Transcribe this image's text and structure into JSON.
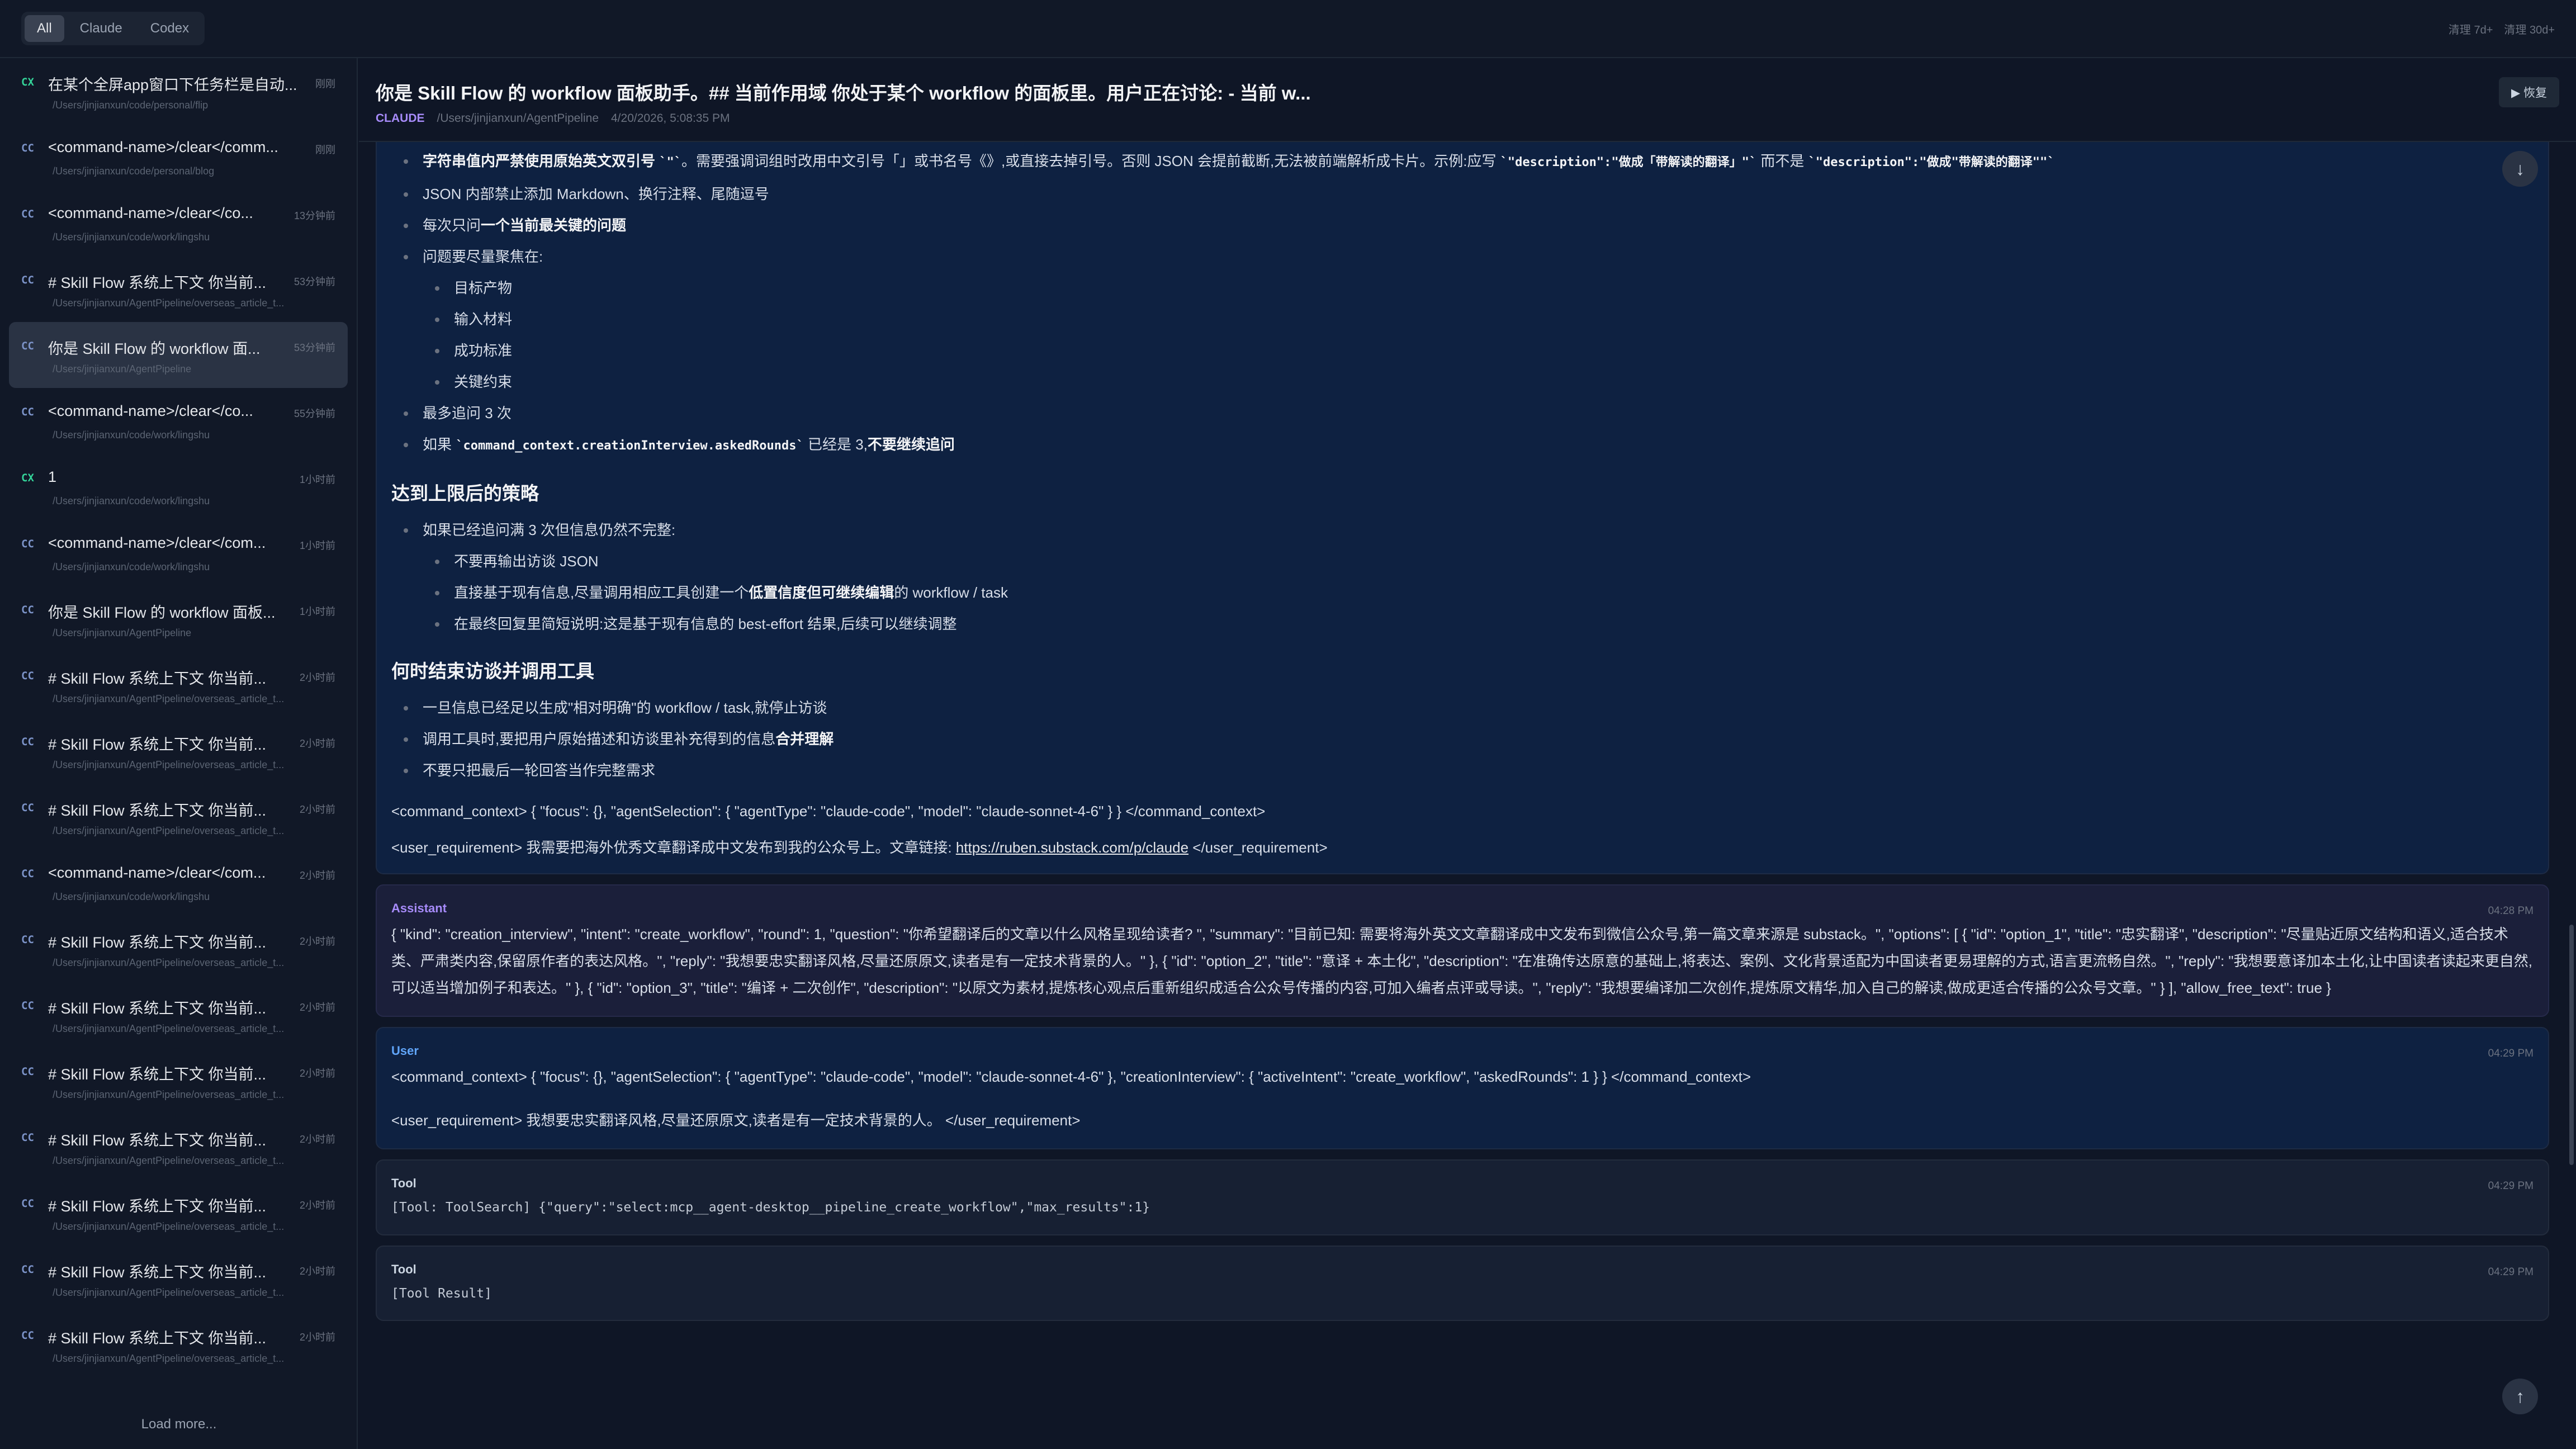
{
  "filters": {
    "items": [
      "All",
      "Claude",
      "Codex"
    ],
    "active": "All"
  },
  "topbar": {
    "clean_7d": "清理 7d+",
    "clean_30d": "清理 30d+"
  },
  "sidebar": {
    "sessions": [
      {
        "tag": "CX",
        "title": "在某个全屏app窗口下任务栏是自动...",
        "time": "刚刚",
        "path": "/Users/jinjianxun/code/personal/flip"
      },
      {
        "tag": "CC",
        "title": "<command-name>/clear</comm...",
        "time": "刚刚",
        "path": "/Users/jinjianxun/code/personal/blog"
      },
      {
        "tag": "CC",
        "title": "<command-name>/clear</co...",
        "time": "13分钟前",
        "path": "/Users/jinjianxun/code/work/lingshu"
      },
      {
        "tag": "CC",
        "title": "# Skill Flow 系统上下文 你当前...",
        "time": "53分钟前",
        "path": "/Users/jinjianxun/AgentPipeline/overseas_article_t..."
      },
      {
        "tag": "CC",
        "title": "你是 Skill Flow 的 workflow 面...",
        "time": "53分钟前",
        "path": "/Users/jinjianxun/AgentPipeline"
      },
      {
        "tag": "CC",
        "title": "<command-name>/clear</co...",
        "time": "55分钟前",
        "path": "/Users/jinjianxun/code/work/lingshu"
      },
      {
        "tag": "CX",
        "title": "1",
        "time": "1小时前",
        "path": "/Users/jinjianxun/code/work/lingshu"
      },
      {
        "tag": "CC",
        "title": "<command-name>/clear</com...",
        "time": "1小时前",
        "path": "/Users/jinjianxun/code/work/lingshu"
      },
      {
        "tag": "CC",
        "title": "你是 Skill Flow 的 workflow 面板...",
        "time": "1小时前",
        "path": "/Users/jinjianxun/AgentPipeline"
      },
      {
        "tag": "CC",
        "title": "# Skill Flow 系统上下文 你当前...",
        "time": "2小时前",
        "path": "/Users/jinjianxun/AgentPipeline/overseas_article_t..."
      },
      {
        "tag": "CC",
        "title": "# Skill Flow 系统上下文 你当前...",
        "time": "2小时前",
        "path": "/Users/jinjianxun/AgentPipeline/overseas_article_t..."
      },
      {
        "tag": "CC",
        "title": "# Skill Flow 系统上下文 你当前...",
        "time": "2小时前",
        "path": "/Users/jinjianxun/AgentPipeline/overseas_article_t..."
      },
      {
        "tag": "CC",
        "title": "<command-name>/clear</com...",
        "time": "2小时前",
        "path": "/Users/jinjianxun/code/work/lingshu"
      },
      {
        "tag": "CC",
        "title": "# Skill Flow 系统上下文 你当前...",
        "time": "2小时前",
        "path": "/Users/jinjianxun/AgentPipeline/overseas_article_t..."
      },
      {
        "tag": "CC",
        "title": "# Skill Flow 系统上下文 你当前...",
        "time": "2小时前",
        "path": "/Users/jinjianxun/AgentPipeline/overseas_article_t..."
      },
      {
        "tag": "CC",
        "title": "# Skill Flow 系统上下文 你当前...",
        "time": "2小时前",
        "path": "/Users/jinjianxun/AgentPipeline/overseas_article_t..."
      },
      {
        "tag": "CC",
        "title": "# Skill Flow 系统上下文 你当前...",
        "time": "2小时前",
        "path": "/Users/jinjianxun/AgentPipeline/overseas_article_t..."
      },
      {
        "tag": "CC",
        "title": "# Skill Flow 系统上下文 你当前...",
        "time": "2小时前",
        "path": "/Users/jinjianxun/AgentPipeline/overseas_article_t..."
      },
      {
        "tag": "CC",
        "title": "# Skill Flow 系统上下文 你当前...",
        "time": "2小时前",
        "path": "/Users/jinjianxun/AgentPipeline/overseas_article_t..."
      },
      {
        "tag": "CC",
        "title": "# Skill Flow 系统上下文 你当前...",
        "time": "2小时前",
        "path": "/Users/jinjianxun/AgentPipeline/overseas_article_t..."
      }
    ],
    "selected_index": 4,
    "load_more": "Load more..."
  },
  "header": {
    "title": "你是 Skill Flow 的 workflow 面板助手。## 当前作用域 你处于某个 workflow 的面板里。用户正在讨论: - 当前 w...",
    "badge": "CLAUDE",
    "path": "/Users/jinjianxun/AgentPipeline",
    "datetime": "4/20/2026, 5:08:35 PM",
    "restore_label": "▶ 恢复"
  },
  "first_msg": {
    "b1_pre": "字符串值内严禁使用原始英文双引号 ",
    "b1_code": "`\"`",
    "b1_post": "。需要强调词组时改用中文引号「」或书名号《》,或直接去掉引号。否则 JSON 会提前截断,无法被前端解析成卡片。示例:应写 ",
    "b1_ex1": "`\"description\":\"做成「带解读的翻译」\"`",
    "b1_mid": " 而不是 ",
    "b1_ex2": "`\"description\":\"做成\"带解读的翻译\"\"`",
    "b2": "JSON 内部禁止添加 Markdown、换行注释、尾随逗号",
    "b3_pre": "每次只问",
    "b3_bold": "一个当前最关键的问题",
    "b4": "问题要尽量聚焦在:",
    "focus": [
      "目标产物",
      "输入材料",
      "成功标准",
      "关键约束"
    ],
    "b5": "最多追问 3 次",
    "b6_pre": "如果 ",
    "b6_code": "`command_context.creationInterview.askedRounds`",
    "b6_mid": " 已经是 3,",
    "b6_bold": "不要继续追问",
    "h_limit": "达到上限后的策略",
    "l1": "如果已经追问满 3 次但信息仍然不完整:",
    "l1_sub": [
      {
        "pre": "不要再输出访谈 JSON",
        "bold": "",
        "post": ""
      },
      {
        "pre": "直接基于现有信息,尽量调用相应工具创建一个",
        "bold": "低置信度但可继续编辑",
        "post": "的 workflow / task"
      },
      {
        "pre": "在最终回复里简短说明:这是基于现有信息的 best-effort 结果,后续可以继续调整",
        "bold": "",
        "post": ""
      }
    ],
    "h_end": "何时结束访谈并调用工具",
    "e1": "一旦信息已经足以生成\"相对明确\"的 workflow / task,就停止访谈",
    "e2_pre": "调用工具时,要把用户原始描述和访谈里补充得到的信息",
    "e2_bold": "合并理解",
    "e3": "不要只把最后一轮回答当作完整需求",
    "cmd_ctx": "<command_context> { \"focus\": {}, \"agentSelection\": { \"agentType\": \"claude-code\", \"model\": \"claude-sonnet-4-6\" } } </command_context>",
    "req_pre": "<user_requirement> 我需要把海外优秀文章翻译成中文发布到我的公众号上。文章链接: ",
    "req_link": "https://ruben.substack.com/p/claude",
    "req_post": " </user_requirement>"
  },
  "assistant_msg": {
    "role": "Assistant",
    "time": "04:28 PM",
    "text": "{ \"kind\": \"creation_interview\", \"intent\": \"create_workflow\", \"round\": 1, \"question\": \"你希望翻译后的文章以什么风格呈现给读者? \", \"summary\": \"目前已知: 需要将海外英文文章翻译成中文发布到微信公众号,第一篇文章来源是 substack。\", \"options\": [ { \"id\": \"option_1\", \"title\": \"忠实翻译\", \"description\": \"尽量贴近原文结构和语义,适合技术类、严肃类内容,保留原作者的表达风格。\", \"reply\": \"我想要忠实翻译风格,尽量还原原文,读者是有一定技术背景的人。\" }, { \"id\": \"option_2\", \"title\": \"意译 + 本土化\", \"description\": \"在准确传达原意的基础上,将表达、案例、文化背景适配为中国读者更易理解的方式,语言更流畅自然。\", \"reply\": \"我想要意译加本土化,让中国读者读起来更自然,可以适当增加例子和表达。\" }, { \"id\": \"option_3\", \"title\": \"编译 + 二次创作\", \"description\": \"以原文为素材,提炼核心观点后重新组织成适合公众号传播的内容,可加入编者点评或导读。\", \"reply\": \"我想要编译加二次创作,提炼原文精华,加入自己的解读,做成更适合传播的公众号文章。\" } ], \"allow_free_text\": true }"
  },
  "user_msg": {
    "role": "User",
    "time": "04:29 PM",
    "cmd_ctx": "<command_context> { \"focus\": {}, \"agentSelection\": { \"agentType\": \"claude-code\", \"model\": \"claude-sonnet-4-6\" }, \"creationInterview\": { \"activeIntent\": \"create_workflow\", \"askedRounds\": 1 } } </command_context>",
    "req": "<user_requirement> 我想要忠实翻译风格,尽量还原原文,读者是有一定技术背景的人。 </user_requirement>"
  },
  "tool_msg_1": {
    "role": "Tool",
    "time": "04:29 PM",
    "text": "[Tool: ToolSearch] {\"query\":\"select:mcp__agent-desktop__pipeline_create_workflow\",\"max_results\":1}"
  },
  "tool_msg_2": {
    "role": "Tool",
    "time": "04:29 PM",
    "text": "[Tool Result]"
  },
  "icons": {
    "scroll_down": "arrow-down-icon",
    "scroll_up": "arrow-up-icon"
  },
  "colors": {
    "cx_tag": "#34d399",
    "cc_tag": "#7c93c8",
    "claude_badge": "#a78bfa",
    "user_role": "#60a5fa",
    "assistant_role": "#a78bfa"
  }
}
